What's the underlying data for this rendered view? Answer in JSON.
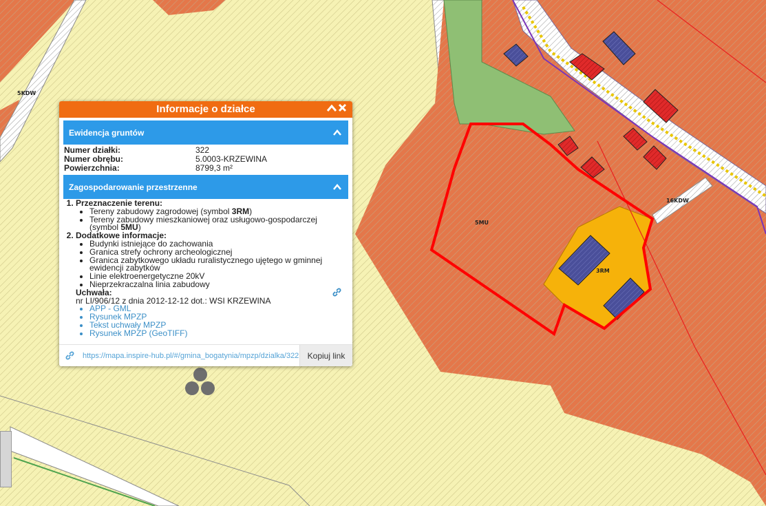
{
  "popup": {
    "title": "Informacje o działce",
    "ewidencja": {
      "title": "Ewidencja gruntów",
      "rows": [
        {
          "key": "Numer działki:",
          "value": "322"
        },
        {
          "key": "Numer obrębu:",
          "value": "5.0003-KRZEWINA"
        },
        {
          "key": "Powierzchnia:",
          "value": "8799,3 m²"
        }
      ]
    },
    "zagospodarowanie": {
      "title": "Zagospodarowanie przestrzenne",
      "przeznaczenie_title": "Przeznaczenie terenu:",
      "przeznaczenie_items": [
        {
          "text": "Tereny zabudowy zagrodowej (symbol ",
          "symbol": "3RM",
          "after": ")"
        },
        {
          "text": "Tereny zabudowy mieszkaniowej oraz usługowo-gospodarczej (symbol ",
          "symbol": "5MU",
          "after": ")"
        }
      ],
      "dodatkowe_title": "Dodatkowe informacje:",
      "dodatkowe_items": [
        "Budynki istniejące do zachowania",
        "Granica strefy ochrony archeologicznej",
        "Granica zabytkowego układu ruralistycznego ujętego w gminnej ewidencji zabytków",
        "Linie elektroenergetyczne 20kV",
        "Nieprzekraczalna linia zabudowy"
      ],
      "uchwala_title": "Uchwała:",
      "uchwala_text": "nr LI/906/12 z dnia 2012-12-12 dot.: WSI KRZEWINA",
      "links": [
        "APP - GML",
        "Rysunek MPZP",
        "Tekst uchwały MPZP",
        "Rysunek MPZP (GeoTIFF)"
      ]
    },
    "footer": {
      "url": "https://mapa.inspire-hub.pl/#/gmina_bogatynia/mpzp/dzialka/322",
      "copy_label": "Kopiuj link"
    }
  },
  "map": {
    "labels": {
      "kdw5": "5KDW",
      "kdw16": "16KDW",
      "mu5": "5MU",
      "rm3": "3RM"
    }
  },
  "icons": {
    "collapse": "chevron-up-icon",
    "close": "close-icon",
    "link": "link-icon",
    "spinner": "loading-spinner-icon"
  },
  "colors": {
    "popup_header": "#f06c12",
    "section_bar": "#2d9ae8",
    "parcel_outline": "#ff0000",
    "zone_mu": "#e4774a",
    "zone_rm": "#f6b20a",
    "zone_agri": "#f6f2b4",
    "buildings": "#4a4f9a",
    "green": "#8fbf74"
  }
}
